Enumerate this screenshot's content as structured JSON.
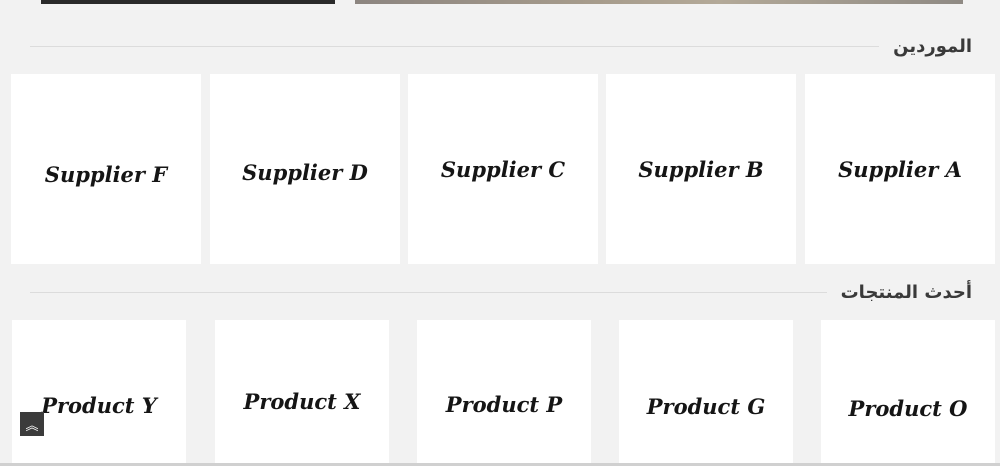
{
  "suppliers": {
    "title": "الموردين",
    "items": [
      {
        "label": "Supplier A"
      },
      {
        "label": "Supplier B"
      },
      {
        "label": "Supplier C"
      },
      {
        "label": "Supplier D"
      },
      {
        "label": "Supplier F"
      }
    ]
  },
  "products": {
    "title": "أحدث المنتجات",
    "items": [
      {
        "label": "Product O"
      },
      {
        "label": "Product G"
      },
      {
        "label": "Product P"
      },
      {
        "label": "Product X"
      },
      {
        "label": "Product Y"
      }
    ]
  },
  "scroll_top": {
    "icon": "double-chevron-up-icon",
    "glyph": "︽"
  }
}
